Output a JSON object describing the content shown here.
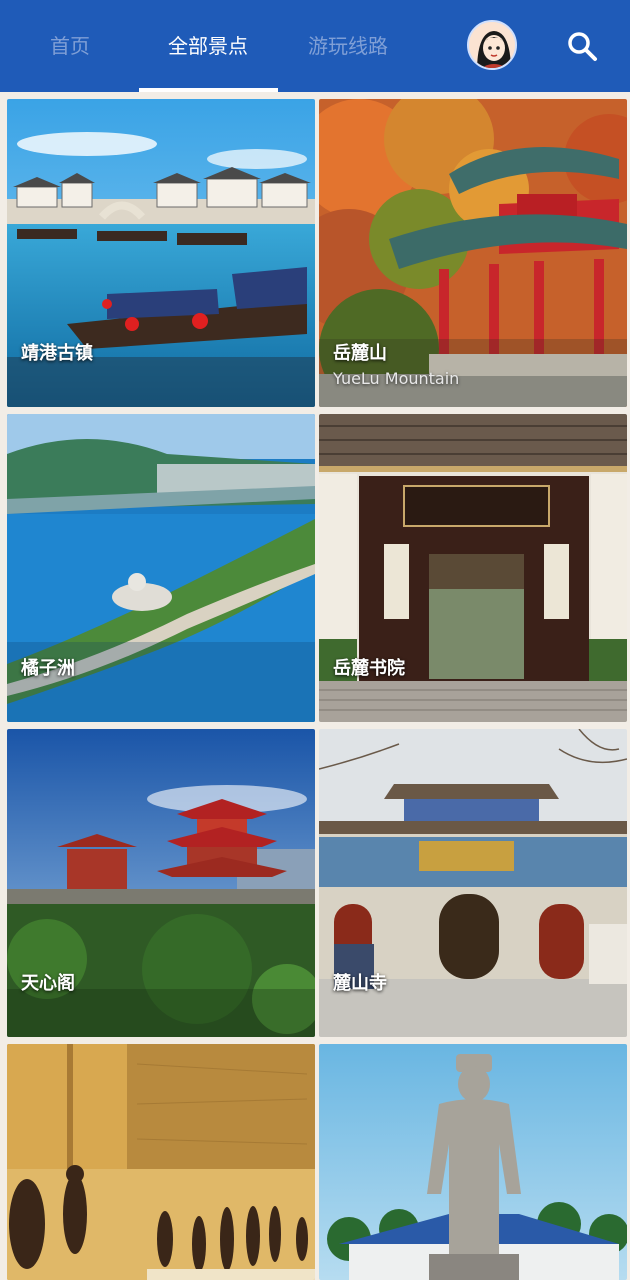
{
  "header": {
    "tabs": [
      {
        "label": "首页",
        "active": false
      },
      {
        "label": "全部景点",
        "active": true
      },
      {
        "label": "游玩线路",
        "active": false
      }
    ],
    "avatar_icon": "user-avatar",
    "search_icon": "search-icon"
  },
  "colors": {
    "header_bg": "#1f5bb8",
    "tab_active": "#ffffff",
    "tab_inactive": "#7f9fd6",
    "page_bg": "#f2ede6"
  },
  "attractions": [
    {
      "name": "靖港古镇"
    },
    {
      "name": "岳麓山",
      "subtitle": "YueLu Mountain"
    },
    {
      "name": "橘子洲"
    },
    {
      "name": "岳麓书院"
    },
    {
      "name": "天心阁"
    },
    {
      "name": "麓山寺"
    },
    {
      "name": ""
    },
    {
      "name": ""
    }
  ]
}
